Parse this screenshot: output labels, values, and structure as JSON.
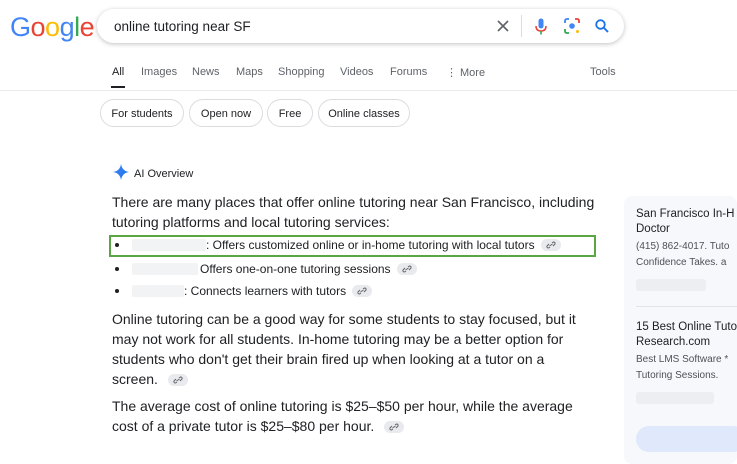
{
  "google_logo": {
    "letters": [
      "G",
      "o",
      "o",
      "g",
      "l",
      "e"
    ],
    "colors": [
      "#4285F4",
      "#EA4335",
      "#FBBC05",
      "#4285F4",
      "#34A853",
      "#EA4335"
    ]
  },
  "search": {
    "query": "online tutoring near SF",
    "icons": [
      "close-icon",
      "microphone-icon",
      "lens-icon",
      "search-icon"
    ]
  },
  "tabs": [
    "All",
    "Images",
    "News",
    "Maps",
    "Shopping",
    "Videos",
    "Forums",
    "More",
    "Tools"
  ],
  "chips": [
    "For students",
    "Open now",
    "Free",
    "Online classes"
  ],
  "ai_overview": {
    "label": "AI Overview",
    "intro": "There are many places that offer online tutoring near San Francisco, including tutoring platforms and local tutoring services:",
    "bullets": [
      ": Offers customized online or in-home tutoring with local tutors",
      "Offers one-on-one tutoring sessions",
      ": Connects learners with tutors"
    ],
    "para1": "Online tutoring can be a good way for some students to stay focused, but it may not work for all students. In-home tutoring may be a better option for students who don't get their brain fired up when looking at a tutor on a screen.",
    "para2": "The average cost of online tutoring is $25–$50 per hour, while the average cost of a private tutor is $25–$80 per hour."
  },
  "sources": [
    {
      "title_line1": "San Francisco In-H",
      "title_line2": "Doctor",
      "sub1": "(415) 862-4017. Tuto",
      "sub2": "Confidence Takes. a"
    },
    {
      "title_line1": "15 Best Online Tuto",
      "title_line2": "Research.com",
      "sub1": "Best LMS Software *",
      "sub2": "Tutoring Sessions."
    }
  ],
  "colors": {
    "accent_blue": "#1a73e8",
    "highlight_green": "#5aa643"
  }
}
